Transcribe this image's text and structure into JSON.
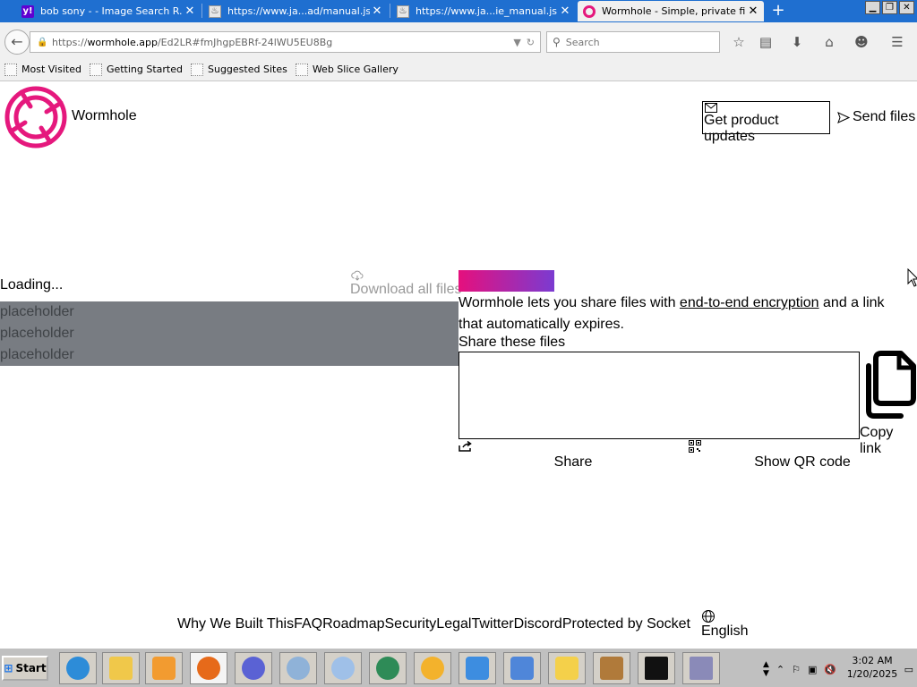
{
  "browser": {
    "tabs": [
      {
        "title": "bob sony - - Image Search R...",
        "active": false,
        "favicon": "yahoo-icon"
      },
      {
        "title": "https://www.ja...ad/manual.jsp",
        "active": false,
        "favicon": "java-icon"
      },
      {
        "title": "https://www.ja...ie_manual.jsp",
        "active": false,
        "favicon": "java-icon"
      },
      {
        "title": "Wormhole - Simple, private fil...",
        "active": true,
        "favicon": "wormhole-icon"
      }
    ],
    "url_prefix": "https://",
    "url_host": "wormhole.app",
    "url_path": "/Ed2LR#fmJhgpEBRf-24lWU5EU8Bg",
    "search_placeholder": "Search",
    "bookmarks": [
      "Most Visited",
      "Getting Started",
      "Suggested Sites",
      "Web Slice Gallery"
    ]
  },
  "page": {
    "brand": "Wormhole",
    "updates_label": "Get product updates",
    "send_label": "Send files",
    "loading": "Loading...",
    "download_all": "Download all files",
    "files": [
      "placeholder",
      "placeholder",
      "placeholder"
    ],
    "intro_pre": "Wormhole lets you share files with ",
    "intro_link": "end-to-end encryption",
    "intro_post": " and a link that automatically expires.",
    "share_label": "Share these files",
    "copy_label": "Copy link",
    "share_button": "Share",
    "qr_button": "Show QR code",
    "footer_links": [
      "Why We Built This",
      "FAQ",
      "Roadmap",
      "Security",
      "Legal",
      "Twitter",
      "Discord",
      "Protected by Socket"
    ],
    "language": "English",
    "accent_pink": "#e5187d",
    "accent_purple": "#7b3bd1"
  },
  "taskbar": {
    "start_label": "Start",
    "time": "3:02 AM",
    "date": "1/20/2025"
  }
}
